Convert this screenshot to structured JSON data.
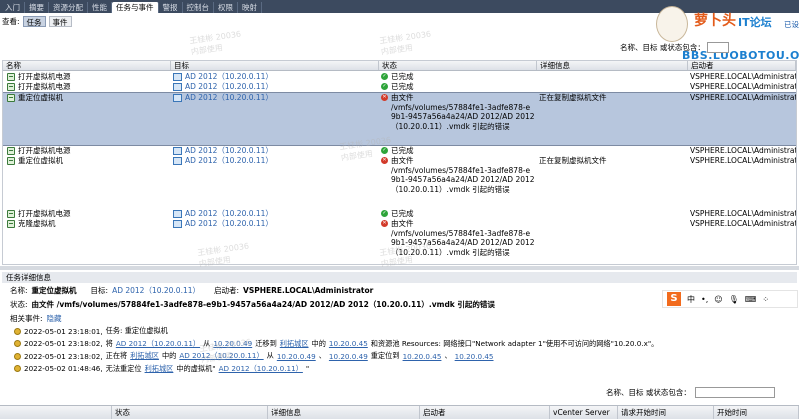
{
  "tabs": [
    "入门",
    "摘要",
    "资源分配",
    "性能",
    "任务与事件",
    "警报",
    "控制台",
    "权限",
    "映射"
  ],
  "active_tab_index": 4,
  "view": {
    "label": "查看:",
    "tasks": "任务",
    "events": "事件"
  },
  "top_filter_label": "名称、目标 或状态包含：",
  "top_right_link": "已设",
  "logo": {
    "brand": "萝卜头",
    "sub": "IT论坛",
    "url": "BBS.LUOBOTOU.ORG"
  },
  "columns": [
    "名称",
    "目标",
    "状态",
    "详细信息",
    "启动者"
  ],
  "rows": [
    {
      "name": "打开虚拟机电源",
      "target": "AD 2012（10.20.0.11）",
      "status": [
        "已完成"
      ],
      "status_type": "ok",
      "detail": "",
      "initiator": "VSPHERE.LOCAL\\Administrator"
    },
    {
      "name": "打开虚拟机电源",
      "target": "AD 2012（10.20.0.11）",
      "status": [
        "已完成"
      ],
      "status_type": "ok",
      "detail": "",
      "initiator": "VSPHERE.LOCAL\\Administrator"
    },
    {
      "name": "重定位虚拟机",
      "target": "AD 2012（10.20.0.11）",
      "status": [
        "由文件",
        "/vmfs/volumes/57884fe1-3adfe878-e",
        "9b1-9457a56a4a24/AD 2012/AD 2012",
        "（10.20.0.11）.vmdk 引起的错误"
      ],
      "status_type": "err",
      "detail": "正在复制虚拟机文件",
      "initiator": "VSPHERE.LOCAL\\Administrator",
      "selected": true
    },
    {
      "name": "打开虚拟机电源",
      "target": "AD 2012（10.20.0.11）",
      "status": [
        "已完成"
      ],
      "status_type": "ok",
      "detail": "",
      "initiator": "VSPHERE.LOCAL\\Administrator"
    },
    {
      "name": "重定位虚拟机",
      "target": "AD 2012（10.20.0.11）",
      "status": [
        "由文件",
        "/vmfs/volumes/57884fe1-3adfe878-e",
        "9b1-9457a56a4a24/AD 2012/AD 2012",
        "（10.20.0.11）.vmdk 引起的错误"
      ],
      "status_type": "err",
      "detail": "正在复制虚拟机文件",
      "initiator": "VSPHERE.LOCAL\\Administrator"
    },
    {
      "name": "打开虚拟机电源",
      "target": "AD 2012（10.20.0.11）",
      "status": [
        "已完成"
      ],
      "status_type": "ok",
      "detail": "",
      "initiator": "VSPHERE.LOCAL\\Administrator"
    },
    {
      "name": "克隆虚拟机",
      "target": "AD 2012（10.20.0.11）",
      "status": [
        "由文件",
        "/vmfs/volumes/57884fe1-3adfe878-e",
        "9b1-9457a56a4a24/AD 2012/AD 2012",
        "（10.20.0.11）.vmdk 引起的错误"
      ],
      "status_type": "err",
      "detail": "",
      "initiator": "VSPHERE.LOCAL\\Administrator"
    }
  ],
  "detail": {
    "header": "任务详细信息",
    "name_label": "名称:",
    "name_value": "重定位虚拟机",
    "target_label": "目标:",
    "target_value": "AD 2012（10.20.0.11）",
    "initiator_label": "启动者:",
    "initiator_value": "VSPHERE.LOCAL\\Administrator",
    "status_label": "状态:",
    "status_value": "由文件 /vmfs/volumes/57884fe1-3adfe878-e9b1-9457a56a4a24/AD 2012/AD 2012（10.20.0.11）.vmdk 引起的错误",
    "related_label": "相关事件:",
    "related_link": "隐藏"
  },
  "events": [
    {
      "time": "2022-05-01 23:18:01,",
      "parts": [
        "任务: 重定位虚拟机"
      ]
    },
    {
      "time": "2022-05-01 23:18:02,",
      "parts": [
        "将",
        "AD 2012（10.20.0.11）",
        "从",
        "10.20.0.49",
        "迁移到",
        "利拓城区",
        "中的",
        "10.20.0.45",
        "和资源池 Resources: 网络接口\"Network adapter 1\"使用不可访问的网络\"10.20.0.x\"。"
      ]
    },
    {
      "time": "2022-05-01 23:18:02,",
      "parts": [
        "正在将",
        "利拓城区",
        "中的",
        "AD 2012（10.20.0.11）",
        "从",
        "10.20.0.49",
        "、",
        "10.20.0.49",
        "重定位到",
        "10.20.0.45",
        "、",
        "10.20.0.45"
      ]
    },
    {
      "time": "2022-05-02 01:48:46,",
      "parts": [
        "无法重定位",
        "利拓城区",
        "中的虚拟机\"",
        "AD 2012（10.20.0.11）",
        "\""
      ]
    }
  ],
  "bottom_filter_label": "名称、目标 或状态包含：",
  "bottom_columns": [
    "",
    "状态",
    "详细信息",
    "启动者",
    "vCenter Server",
    "请求开始时间",
    "开始时间"
  ],
  "ime_bar": {
    "logo": "S",
    "lang": "中",
    "punct": "•,",
    "emoji": "☺",
    "mic": "🎙",
    "kbd": "⌨",
    "more": "⁘"
  },
  "watermark": {
    "line1": "王桂彬 20036",
    "line2": "内部使用"
  }
}
